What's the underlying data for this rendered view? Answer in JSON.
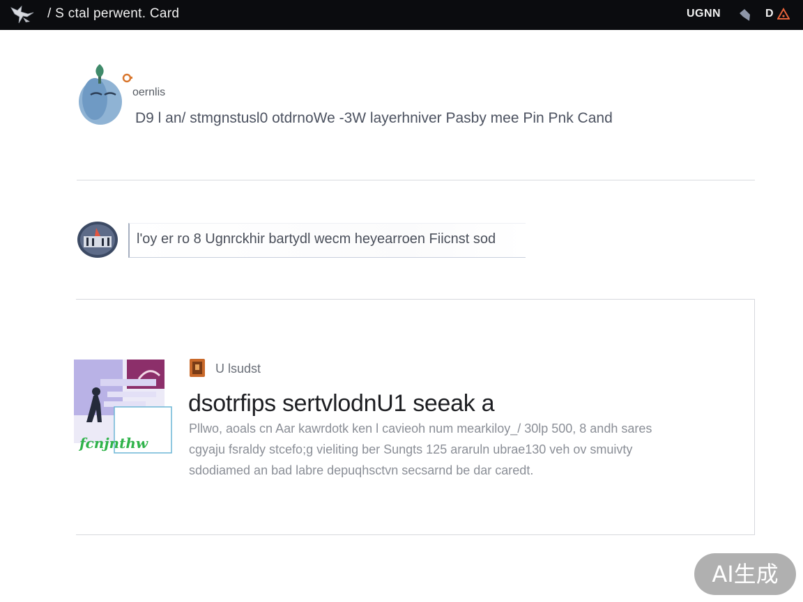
{
  "header": {
    "breadcrumb": "/ S ctal  perwent. Card",
    "user_label": "UGNN",
    "menu_label": "D",
    "icons": {
      "logo": "bird-logo-icon",
      "tag": "tag-icon",
      "alert": "alert-icon"
    }
  },
  "post1": {
    "handle": "oernlis",
    "text": "D9  l an/ stmgnstusl0  otdrnoWe -3W layerhniver Pasby mee  Pin Pnk Cand"
  },
  "post2": {
    "text": "l'oy er  ro 8 Ugnrckhir bartydl wecm  heyearroen Fiicnst sod"
  },
  "card": {
    "badge_label": "U lsudst",
    "title": "dsotrfips sertvlodnU1 seeak a",
    "thumb_caption": "fcnjnthw",
    "body": [
      "Pllwo, aoals  cn Aar kawrdotk ken l cavieoh num mearkiloy_/ 30lp 500, 8 andh sares",
      "cgyaju fsraldy  stcefo;g vieliting  ber Sungts  125 araruln  ubrae130  veh ov smuivty",
      "sdodiamed  an bad labre  depuqhsctvn secsarnd  be dar caredt."
    ]
  },
  "watermark": "AI生成",
  "colors": {
    "topbar": "#0b0c0f",
    "divider": "#d9dbe0",
    "title": "#1c1d21",
    "body": "#8a8e96",
    "accent_green": "#2fb34a",
    "accent_purple": "#8c2f6a"
  }
}
